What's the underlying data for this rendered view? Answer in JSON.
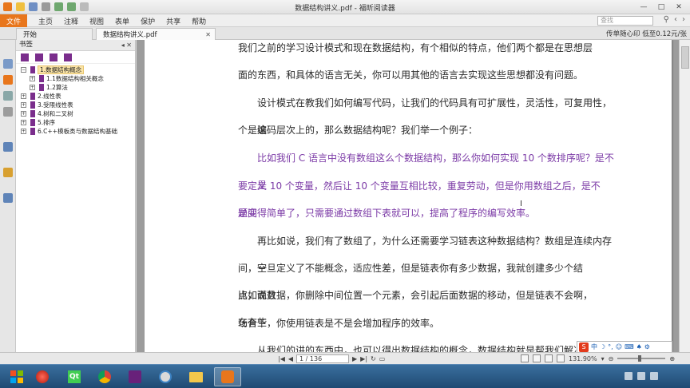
{
  "window": {
    "title": "数据结构讲义.pdf - 福昕阅读器"
  },
  "menu": {
    "file": "文件",
    "items": [
      "主页",
      "注释",
      "视图",
      "表单",
      "保护",
      "共享",
      "帮助"
    ],
    "search_placeholder": "查找"
  },
  "tabs": {
    "start": "开始",
    "doc": "数据结构讲义.pdf",
    "status": "传单随心印 低至0.12元/张"
  },
  "bookmarks": {
    "header": "书签",
    "items": [
      {
        "label": "1.数据结构概念",
        "level": 0,
        "expanded": true
      },
      {
        "label": "1.1数据结构相关概念",
        "level": 1
      },
      {
        "label": "1.2算法",
        "level": 1
      },
      {
        "label": "2.线性表",
        "level": 0
      },
      {
        "label": "3.受限线性表",
        "level": 0
      },
      {
        "label": "4.树和二叉树",
        "level": 0
      },
      {
        "label": "5.排序",
        "level": 0
      },
      {
        "label": "6.C++模板类与数据结构基础",
        "level": 0
      }
    ]
  },
  "document": {
    "lines": [
      {
        "text": "我们之前的学习设计模式和现在数据结构，有个相似的特点，他们两个都是在思想层",
        "indent": false,
        "color": "normal"
      },
      {
        "text": "面的东西，和具体的语言无关，你可以用其他的语言去实现这些思想都没有问题。",
        "indent": false,
        "color": "normal"
      },
      {
        "text": "设计模式在教我们如何编写代码，让我们的代码具有可扩展性，灵活性，可复用性，这",
        "indent": true,
        "color": "normal"
      },
      {
        "text": "个是编码层次上的，那么数据结构呢？我们举一个例子：",
        "indent": false,
        "color": "normal"
      },
      {
        "text": "比如我们 C 语言中没有数组这么个数据结构，那么你如何实现 10 个数排序呢？是不是",
        "indent": true,
        "color": "purple"
      },
      {
        "text": "要定义 10 个变量，然后让 10 个变量互相比较，重复劳动，但是你用数组之后，是不是问",
        "indent": false,
        "color": "purple"
      },
      {
        "text": "题变得简单了，只需要通过数组下表就可以，提高了程序的编写效率。",
        "indent": false,
        "color": "purple"
      },
      {
        "text": "再比如说，我们有了数组了，为什么还需要学习链表这种数据结构？数组是连续内存空",
        "indent": true,
        "color": "normal"
      },
      {
        "text": "间，一旦定义了不能概念，适应性差，但是链表你有多少数据，我就创建多少个结点，而且",
        "indent": false,
        "color": "normal"
      },
      {
        "text": "比如说数据，你删除中间位置一个元素，会引起后面数据的移动，但是链表不会啊，在有些",
        "indent": false,
        "color": "normal"
      },
      {
        "text": "场合下，你使用链表是不是会增加程序的效率。",
        "indent": false,
        "color": "normal"
      },
      {
        "text": "从我们的讲的东西中，也可以得出数据结构的概念，数据结构就是帮我们解决如何依",
        "indent": true,
        "color": "normal"
      }
    ]
  },
  "statusbar": {
    "page": "1 / 136",
    "zoom": "131.90%"
  },
  "ime": {
    "lang": "中"
  },
  "taskbar": {
    "apps": [
      "windows-start",
      "ie",
      "qt",
      "chrome",
      "visual-studio",
      "paint",
      "explorer",
      "foxit-reader"
    ]
  },
  "colors": {
    "accent": "#e8761c",
    "bookmark_flag": "#7a2d8c",
    "purple_text": "#7b3aa6",
    "taskbar": "#1f4a73"
  }
}
